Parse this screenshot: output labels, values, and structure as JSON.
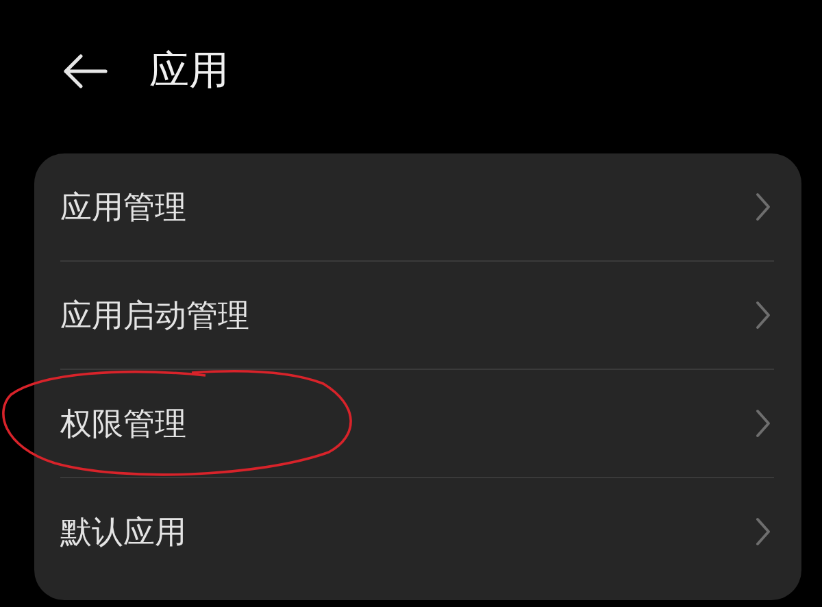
{
  "header": {
    "title": "应用"
  },
  "items": [
    {
      "label": "应用管理",
      "annotated": false
    },
    {
      "label": "应用启动管理",
      "annotated": false
    },
    {
      "label": "权限管理",
      "annotated": true
    },
    {
      "label": "默认应用",
      "annotated": false
    }
  ]
}
